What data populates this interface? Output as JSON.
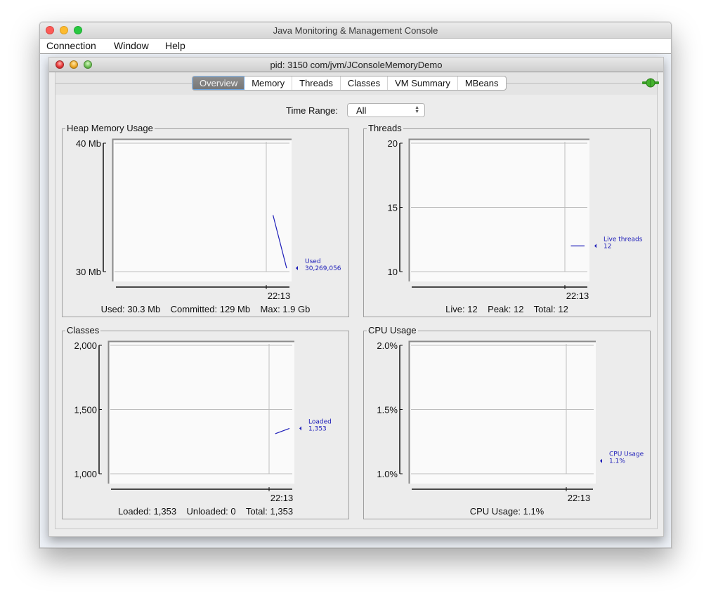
{
  "window": {
    "title": "Java Monitoring & Management Console",
    "menu": [
      "Connection",
      "Window",
      "Help"
    ]
  },
  "frame": {
    "title": "pid: 3150 com/jvm/JConsoleMemoryDemo",
    "connection_icon": "connected-plug-icon"
  },
  "tabs": [
    {
      "label": "Overview",
      "active": true
    },
    {
      "label": "Memory",
      "active": false
    },
    {
      "label": "Threads",
      "active": false
    },
    {
      "label": "Classes",
      "active": false
    },
    {
      "label": "VM Summary",
      "active": false
    },
    {
      "label": "MBeans",
      "active": false
    }
  ],
  "time_range": {
    "label": "Time Range:",
    "value": "All"
  },
  "colors": {
    "series": "#1c1cb8",
    "legend": "#1c1cb8"
  },
  "panels": {
    "heap": {
      "title": "Heap Memory Usage",
      "summary": "Used: 30.3 Mb    Committed: 129 Mb    Max: 1.9 Gb"
    },
    "threads": {
      "title": "Threads",
      "summary": "Live: 12    Peak: 12    Total: 12"
    },
    "classes": {
      "title": "Classes",
      "summary": "Loaded: 1,353    Unloaded: 0    Total: 1,353"
    },
    "cpu": {
      "title": "CPU Usage",
      "summary": "CPU Usage: 1.1%"
    }
  },
  "chart_data": [
    {
      "id": "heap",
      "type": "line",
      "title": "Heap Memory Usage",
      "yticks": [
        "40 Mb",
        "30 Mb"
      ],
      "ylim": [
        30,
        40
      ],
      "yunit": "Mb",
      "xticks": [
        "22:13"
      ],
      "grid": true,
      "series": [
        {
          "name": "Used",
          "value_label": "30,269,056",
          "points": [
            [
              0.92,
              34.4
            ],
            [
              1.0,
              30.27
            ]
          ]
        }
      ]
    },
    {
      "id": "threads",
      "type": "line",
      "title": "Threads",
      "yticks": [
        "20",
        "15",
        "10"
      ],
      "ylim": [
        10,
        20
      ],
      "xticks": [
        "22:13"
      ],
      "grid": true,
      "series": [
        {
          "name": "Live threads",
          "value_label": "12",
          "points": [
            [
              0.92,
              12
            ],
            [
              1.0,
              12
            ]
          ]
        }
      ]
    },
    {
      "id": "classes",
      "type": "line",
      "title": "Classes",
      "yticks": [
        "2,000",
        "1,500",
        "1,000"
      ],
      "ylim": [
        1000,
        2000
      ],
      "xticks": [
        "22:13"
      ],
      "grid": true,
      "series": [
        {
          "name": "Loaded",
          "value_label": "1,353",
          "points": [
            [
              0.92,
              1312
            ],
            [
              1.0,
              1353
            ]
          ]
        }
      ]
    },
    {
      "id": "cpu",
      "type": "line",
      "title": "CPU Usage",
      "yticks": [
        "2.0%",
        "1.5%",
        "1.0%"
      ],
      "ylim": [
        1.0,
        2.0
      ],
      "xticks": [
        "22:13"
      ],
      "grid": true,
      "series": [
        {
          "name": "CPU Usage",
          "value_label": "1.1%",
          "points": [
            [
              1.0,
              1.1
            ]
          ]
        }
      ]
    }
  ]
}
